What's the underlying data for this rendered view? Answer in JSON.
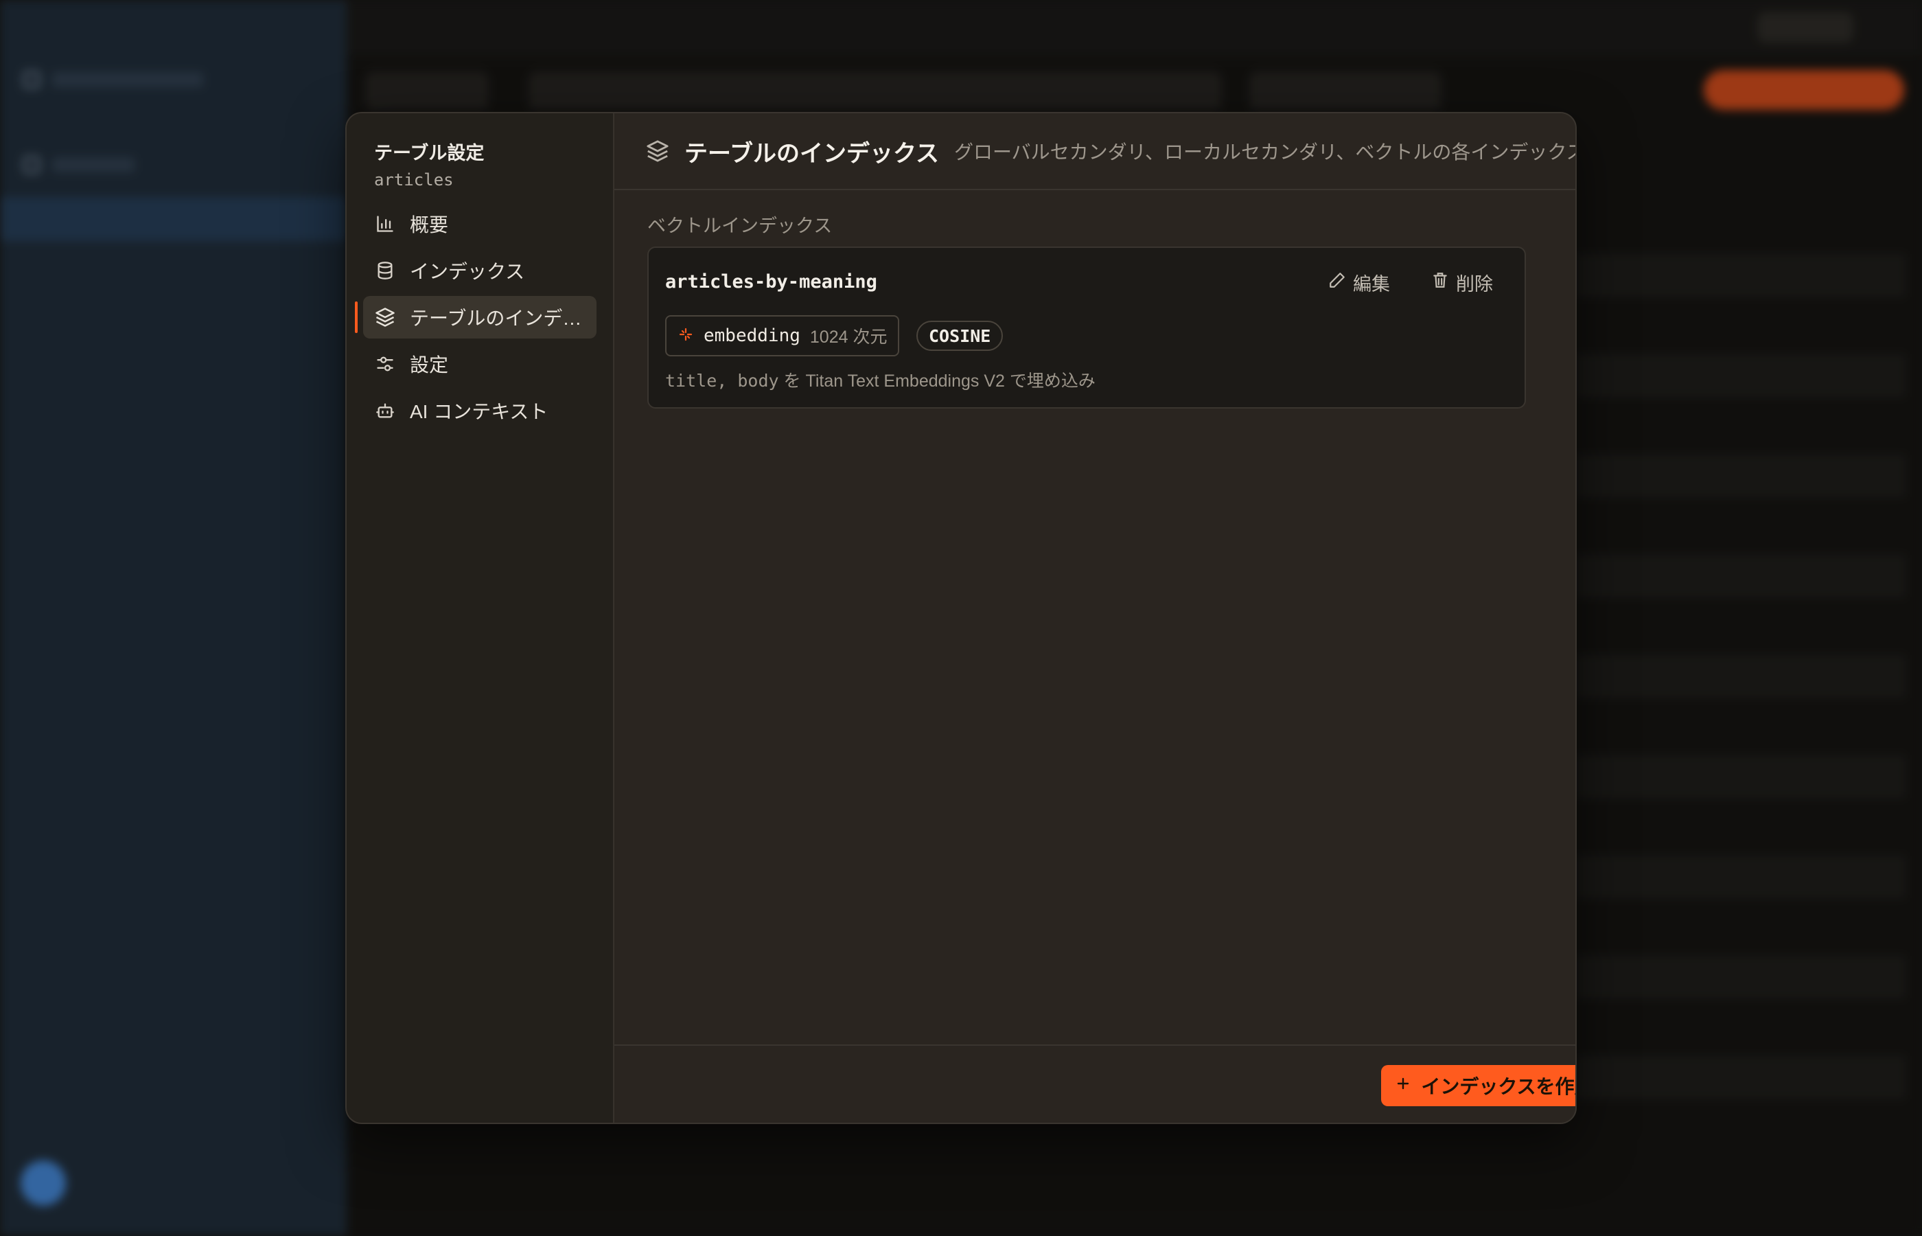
{
  "modal": {
    "nav": {
      "title": "テーブル設定",
      "subtitle": "articles",
      "items": [
        {
          "label": "概要",
          "icon": "bar-chart-icon"
        },
        {
          "label": "インデックス",
          "icon": "database-icon"
        },
        {
          "label": "テーブルのインデックス",
          "icon": "layers-icon",
          "active": true
        },
        {
          "label": "設定",
          "icon": "sliders-icon"
        },
        {
          "label": "AI コンテキスト",
          "icon": "bot-icon"
        }
      ]
    },
    "header": {
      "title": "テーブルのインデックス",
      "description": "グローバルセカンダリ、ローカルセカンダリ、ベクトルの各インデックス"
    },
    "section_label": "ベクトルインデックス",
    "index_card": {
      "name": "articles-by-meaning",
      "edit_label": "編集",
      "delete_label": "削除",
      "field": "embedding",
      "dimensions": "1024 次元",
      "metric": "COSINE",
      "description_fields": "title, body",
      "description_text": "を Titan Text Embeddings V2 で埋め込み"
    },
    "create_button_label": "インデックスを作成"
  },
  "colors": {
    "accent": "#ff5b1e",
    "modal_bg": "#2a2520",
    "nav_bg": "#23201b",
    "card_bg": "#1c1a17"
  }
}
